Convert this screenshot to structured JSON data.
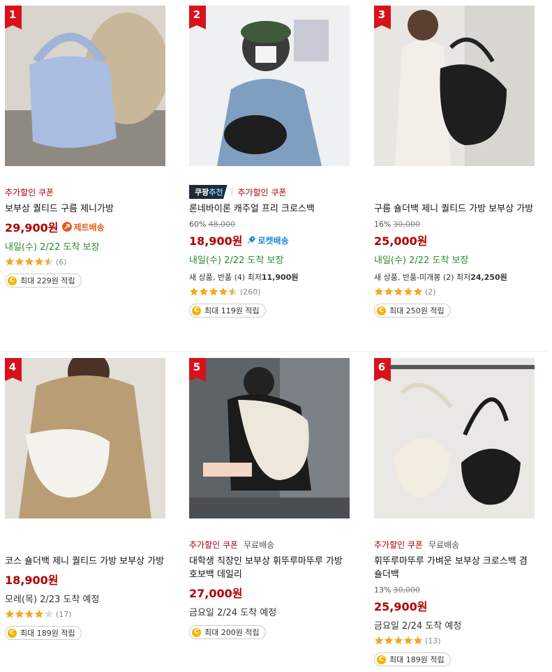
{
  "products": [
    {
      "rank": "1",
      "tags": {
        "recommend": null,
        "coupon": "추가할인 쿠폰",
        "free_shipping": null
      },
      "name": "보부상 퀄티드 구름 제니가방",
      "discount_pct": null,
      "original_price": null,
      "price": "29,900원",
      "badge": {
        "type": "jet",
        "label": "제트배송",
        "icon": "jet-icon",
        "color": "#e85a1e"
      },
      "delivery": "내일(수) 2/22 도착 보장",
      "delivery_style": "guaranteed",
      "new_used": null,
      "rating": 4.5,
      "review_count": "(6)",
      "cashback": "최대 229원 적립"
    },
    {
      "rank": "2",
      "tags": {
        "recommend": {
          "prefix": "쿠팡",
          "accent": "추천"
        },
        "coupon": "추가할인 쿠폰",
        "free_shipping": null
      },
      "name": "론네바이론 캐주얼 프리 크로스백",
      "discount_pct": "60%",
      "original_price": "48,000",
      "price": "18,900원",
      "badge": {
        "type": "rocket",
        "label": "로켓배송",
        "icon": "rocket-icon",
        "color": "#1e88d6"
      },
      "delivery": "내일(수) 2/22 도착 보장",
      "delivery_style": "guaranteed",
      "new_used": {
        "label": "새 상품, 반품 (4) 최저",
        "price": "11,900원"
      },
      "rating": 4.5,
      "review_count": "(260)",
      "cashback": "최대 119원 적립"
    },
    {
      "rank": "3",
      "tags": null,
      "name": "구름 숄더백 제니 퀄티드 가방 보부상 가방",
      "discount_pct": "16%",
      "original_price": "30,000",
      "price": "25,000원",
      "badge": null,
      "delivery": "내일(수) 2/22 도착 보장",
      "delivery_style": "guaranteed",
      "new_used": {
        "label": "새 상품, 반품-미개봉 (2) 최저",
        "price": "24,250원"
      },
      "rating": 5,
      "review_count": "(2)",
      "cashback": "최대 250원 적립"
    },
    {
      "rank": "4",
      "tags": null,
      "name": "코스 숄더백 제니 퀄티드 가방 보부상 가방",
      "discount_pct": null,
      "original_price": null,
      "price": "18,900원",
      "badge": null,
      "delivery": "모레(목) 2/23 도착 예정",
      "delivery_style": "plain",
      "new_used": null,
      "rating": 4,
      "review_count": "(17)",
      "cashback": "최대 189원 적립"
    },
    {
      "rank": "5",
      "tags": {
        "recommend": null,
        "coupon": "추가할인 쿠폰",
        "free_shipping": "무료배송"
      },
      "name": "대학생 직장인 보부상 휘뚜루마뚜루 가방 호보백 데일리",
      "discount_pct": null,
      "original_price": null,
      "price": "27,000원",
      "badge": null,
      "delivery": "금요일 2/24 도착 예정",
      "delivery_style": "plain",
      "new_used": null,
      "rating": null,
      "review_count": null,
      "cashback": "최대 200원 적립"
    },
    {
      "rank": "6",
      "tags": {
        "recommend": null,
        "coupon": "추가할인 쿠폰",
        "free_shipping": "무료배송"
      },
      "name": "휘뚜루마뚜루 가벼운 보부상 크로스백 겸 숄더백",
      "discount_pct": "13%",
      "original_price": "30,000",
      "price": "25,900원",
      "badge": null,
      "delivery": "금요일 2/24 도착 예정",
      "delivery_style": "plain",
      "new_used": null,
      "rating": 5,
      "review_count": "(13)",
      "cashback": "최대 189원 적립"
    }
  ],
  "colors": {
    "accent_red": "#d8121b",
    "price_red": "#ae0000",
    "delivery_green": "#2d8a2d",
    "star": "#f5a623"
  }
}
